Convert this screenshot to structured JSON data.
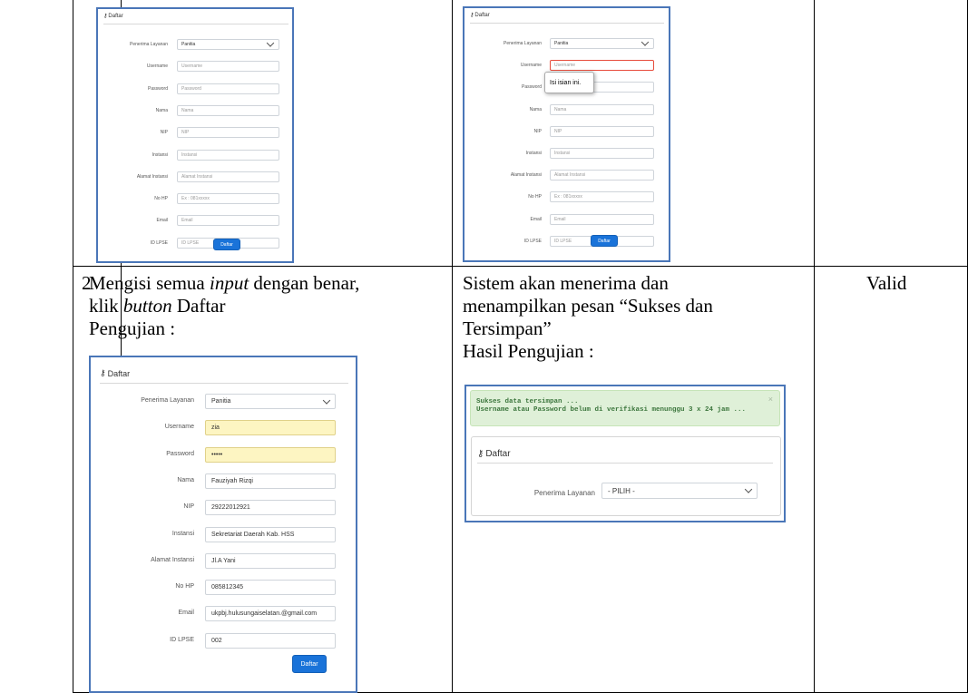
{
  "table": {
    "rows": [
      {
        "top_left_form": {
          "title": "Daftar",
          "fields": [
            {
              "label": "Penerima Layanan",
              "value": "Panitia",
              "type": "select"
            },
            {
              "label": "Username",
              "placeholder": "Username"
            },
            {
              "label": "Password",
              "placeholder": "Password"
            },
            {
              "label": "Nama",
              "placeholder": "Nama"
            },
            {
              "label": "NIP",
              "placeholder": "NIP"
            },
            {
              "label": "Instansi",
              "placeholder": "Instansi"
            },
            {
              "label": "Alamat Instansi",
              "placeholder": "Alamat Instansi"
            },
            {
              "label": "No HP",
              "placeholder": "Ex : 081xxxxx"
            },
            {
              "label": "Email",
              "placeholder": "Email"
            },
            {
              "label": "ID LPSE",
              "placeholder": "ID LPSE"
            }
          ],
          "button": "Daftar"
        },
        "top_right_form": {
          "title": "Daftar",
          "fields": [
            {
              "label": "Penerima Layanan",
              "value": "Panitia",
              "type": "select"
            },
            {
              "label": "Username",
              "placeholder": "Username"
            },
            {
              "label": "Password",
              "placeholder": ""
            },
            {
              "label": "Nama",
              "placeholder": "Nama"
            },
            {
              "label": "NIP",
              "placeholder": "NIP"
            },
            {
              "label": "Instansi",
              "placeholder": "Instansi"
            },
            {
              "label": "Alamat Instansi",
              "placeholder": "Alamat Instansi"
            },
            {
              "label": "No HP",
              "placeholder": "Ex : 081xxxxx"
            },
            {
              "label": "Email",
              "placeholder": "Email"
            },
            {
              "label": "ID LPSE",
              "placeholder": "ID LPSE"
            }
          ],
          "tooltip": "Isi isian ini.",
          "button": "Daftar"
        }
      },
      {
        "number": "2",
        "scenario_line1": "Mengisi semua ",
        "scenario_line1_italic": "input",
        "scenario_line1_end": " dengan benar,",
        "scenario_line2_start": "klik ",
        "scenario_line2_italic": "button",
        "scenario_line2_end": " Daftar",
        "scenario_line3": "Pengujian :",
        "expected_line1": "Sistem akan menerima dan",
        "expected_line2": "menampilkan pesan “Sukses dan",
        "expected_line3": "Tersimpan”",
        "expected_line4": "Hasil Pengujian :",
        "result": "Valid",
        "test_form": {
          "title": "Daftar",
          "fields": [
            {
              "label": "Penerima Layanan",
              "value": "Panitia",
              "type": "select"
            },
            {
              "label": "Username",
              "value": "zia",
              "autofill": true
            },
            {
              "label": "Password",
              "value": "•••••",
              "autofill": true
            },
            {
              "label": "Nama",
              "value": "Fauziyah Rizqi"
            },
            {
              "label": "NIP",
              "value": "29222012921"
            },
            {
              "label": "Instansi",
              "value": "Sekretariat Daerah Kab. HSS"
            },
            {
              "label": "Alamat Instansi",
              "value": "Jl.A Yani"
            },
            {
              "label": "No HP",
              "value": "085812345"
            },
            {
              "label": "Email",
              "value": "ukpbj.hulusungaiselatan.@gmail.com"
            },
            {
              "label": "ID LPSE",
              "value": "002"
            }
          ],
          "button": "Daftar"
        },
        "result_screen": {
          "alert_line1": "Sukses data tersimpan ...",
          "alert_line2": "Username atau Password belum di verifikasi menunggu 3 x 24 jam ...",
          "close": "×",
          "title": "Daftar",
          "select_label": "Penerima Layanan",
          "select_value": "- PILIH -"
        }
      }
    ]
  },
  "colors": {
    "frame": "#4a76b8",
    "button": "#1a73d9",
    "alert_bg": "#dff0d8",
    "alert_text": "#3c763d",
    "autofill": "#fdf5c2"
  }
}
